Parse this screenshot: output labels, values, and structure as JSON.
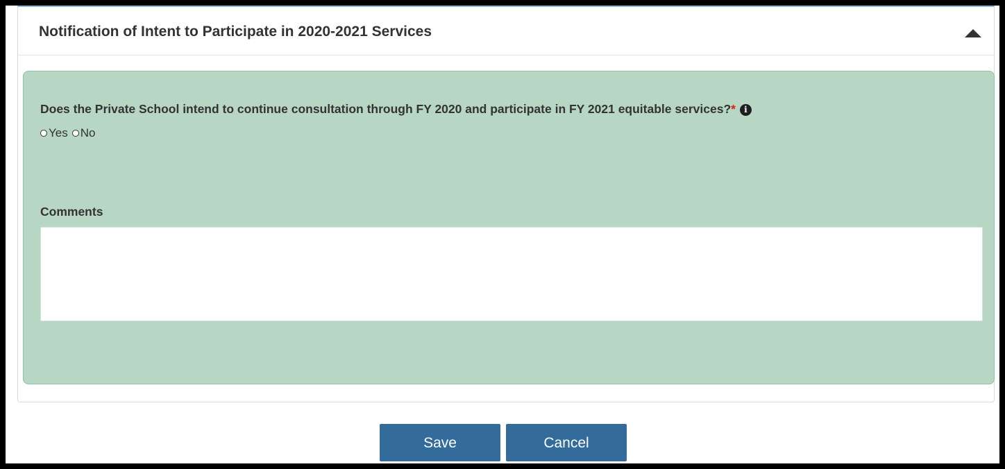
{
  "panel": {
    "title": "Notification of Intent to Participate in 2020-2021 Services"
  },
  "question": {
    "text": "Does the Private School intend to continue consultation through FY 2020 and participate in FY 2021 equitable services?",
    "required_mark": "*",
    "info_icon_glyph": "i",
    "options": [
      {
        "label": "Yes",
        "selected": false
      },
      {
        "label": "No",
        "selected": false
      }
    ]
  },
  "comments": {
    "label": "Comments",
    "value": "",
    "placeholder": ""
  },
  "buttons": {
    "save_label": "Save",
    "cancel_label": "Cancel"
  },
  "colors": {
    "section_background": "#b7d6c3",
    "button_background": "#336b9b",
    "required_mark": "#d9230f"
  },
  "icons": {
    "collapse": "caret-up-icon",
    "info": "info-circle-icon"
  }
}
